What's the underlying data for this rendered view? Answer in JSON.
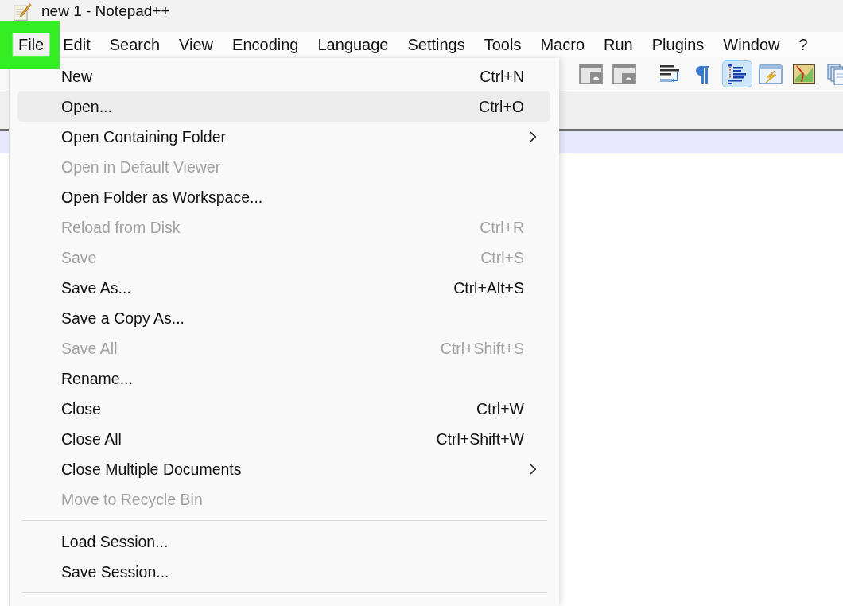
{
  "window": {
    "title": "new 1 - Notepad++"
  },
  "menu_bar": [
    {
      "label": "File",
      "selected": true,
      "highlighted": true
    },
    {
      "label": "Edit",
      "selected": false,
      "highlighted": false
    },
    {
      "label": "Search",
      "selected": false,
      "highlighted": false
    },
    {
      "label": "View",
      "selected": false,
      "highlighted": false
    },
    {
      "label": "Encoding",
      "selected": false,
      "highlighted": false
    },
    {
      "label": "Language",
      "selected": false,
      "highlighted": false
    },
    {
      "label": "Settings",
      "selected": false,
      "highlighted": false
    },
    {
      "label": "Tools",
      "selected": false,
      "highlighted": false
    },
    {
      "label": "Macro",
      "selected": false,
      "highlighted": false
    },
    {
      "label": "Run",
      "selected": false,
      "highlighted": false
    },
    {
      "label": "Plugins",
      "selected": false,
      "highlighted": false
    },
    {
      "label": "Window",
      "selected": false,
      "highlighted": false
    },
    {
      "label": "?",
      "selected": false,
      "highlighted": false
    }
  ],
  "toolbar": {
    "groups": [
      {
        "buttons": [
          {
            "pressed": false
          },
          {
            "pressed": false
          }
        ]
      },
      {
        "buttons": [
          {
            "pressed": false
          },
          {
            "pressed": false
          },
          {
            "pressed": true
          },
          {
            "pressed": false
          },
          {
            "pressed": false
          },
          {
            "pressed": false
          }
        ]
      }
    ]
  },
  "file_menu": {
    "items": [
      {
        "kind": "item",
        "label": "New",
        "shortcut": "Ctrl+N",
        "disabled": false,
        "selected": false,
        "submenu": false
      },
      {
        "kind": "item",
        "label": "Open...",
        "shortcut": "Ctrl+O",
        "disabled": false,
        "selected": true,
        "submenu": false
      },
      {
        "kind": "item",
        "label": "Open Containing Folder",
        "disabled": false,
        "selected": false,
        "submenu": true
      },
      {
        "kind": "item",
        "label": "Open in Default Viewer",
        "disabled": true,
        "selected": false,
        "submenu": false
      },
      {
        "kind": "item",
        "label": "Open Folder as Workspace...",
        "disabled": false,
        "selected": false,
        "submenu": false
      },
      {
        "kind": "item",
        "label": "Reload from Disk",
        "shortcut": "Ctrl+R",
        "disabled": true,
        "selected": false,
        "submenu": false
      },
      {
        "kind": "item",
        "label": "Save",
        "shortcut": "Ctrl+S",
        "disabled": true,
        "selected": false,
        "submenu": false
      },
      {
        "kind": "item",
        "label": "Save As...",
        "shortcut": "Ctrl+Alt+S",
        "disabled": false,
        "selected": false,
        "submenu": false
      },
      {
        "kind": "item",
        "label": "Save a Copy As...",
        "disabled": false,
        "selected": false,
        "submenu": false
      },
      {
        "kind": "item",
        "label": "Save All",
        "shortcut": "Ctrl+Shift+S",
        "disabled": true,
        "selected": false,
        "submenu": false
      },
      {
        "kind": "item",
        "label": "Rename...",
        "disabled": false,
        "selected": false,
        "submenu": false
      },
      {
        "kind": "item",
        "label": "Close",
        "shortcut": "Ctrl+W",
        "disabled": false,
        "selected": false,
        "submenu": false
      },
      {
        "kind": "item",
        "label": "Close All",
        "shortcut": "Ctrl+Shift+W",
        "disabled": false,
        "selected": false,
        "submenu": false
      },
      {
        "kind": "item",
        "label": "Close Multiple Documents",
        "disabled": false,
        "selected": false,
        "submenu": true
      },
      {
        "kind": "item",
        "label": "Move to Recycle Bin",
        "disabled": true,
        "selected": false,
        "submenu": false
      },
      {
        "kind": "separator"
      },
      {
        "kind": "item",
        "label": "Load Session...",
        "disabled": false,
        "selected": false,
        "submenu": false
      },
      {
        "kind": "item",
        "label": "Save Session...",
        "disabled": false,
        "selected": false,
        "submenu": false
      },
      {
        "kind": "separator"
      }
    ]
  }
}
